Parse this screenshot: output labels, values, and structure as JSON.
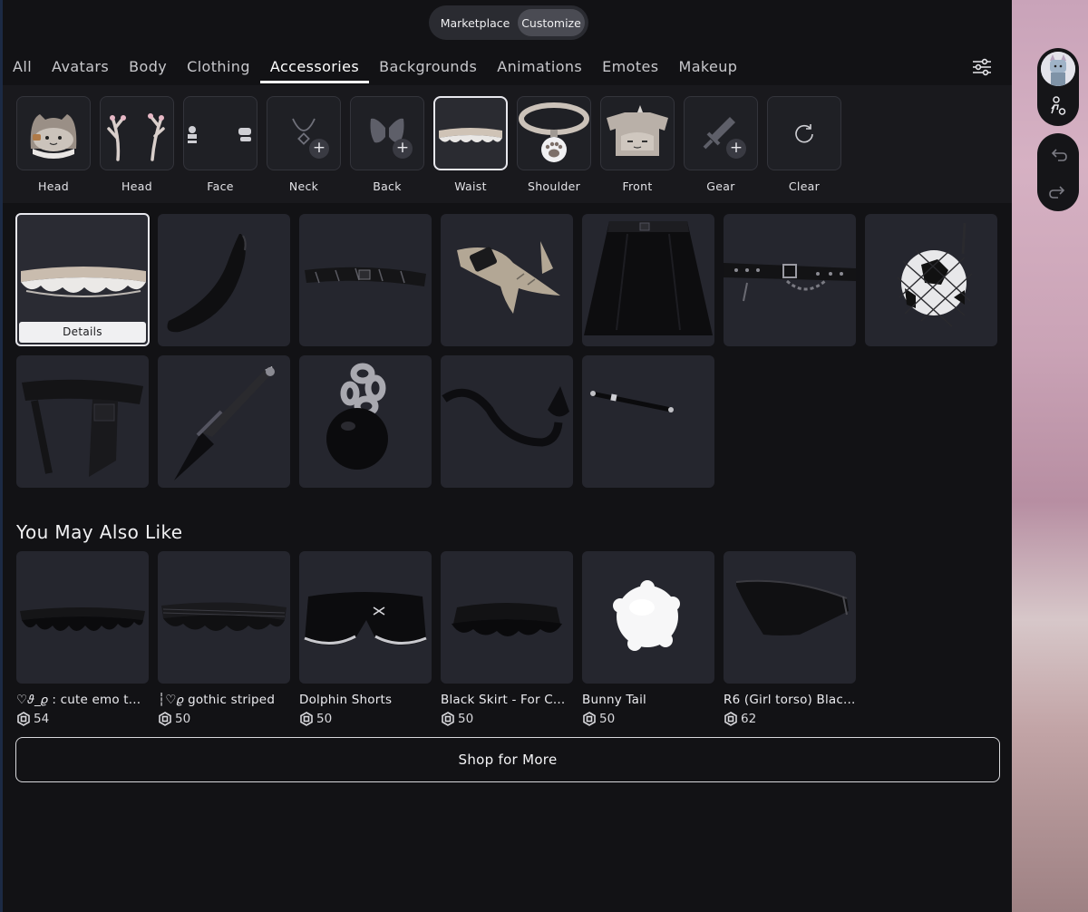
{
  "mode_toggle": {
    "marketplace": "Marketplace",
    "customize": "Customize"
  },
  "tabs": [
    "All",
    "Avatars",
    "Body",
    "Clothing",
    "Accessories",
    "Backgrounds",
    "Animations",
    "Emotes",
    "Makeup"
  ],
  "active_tab": "Accessories",
  "slots": [
    {
      "label": "Head",
      "icon": "cat-hat-icon"
    },
    {
      "label": "Head",
      "icon": "antlers-icon"
    },
    {
      "label": "Face",
      "icon": "face-accessory-icon"
    },
    {
      "label": "Neck",
      "icon": "necklace-icon"
    },
    {
      "label": "Back",
      "icon": "wings-icon"
    },
    {
      "label": "Waist",
      "icon": "ruffle-skirt-icon"
    },
    {
      "label": "Shoulder",
      "icon": "paw-collar-icon"
    },
    {
      "label": "Front",
      "icon": "cat-shirt-icon"
    },
    {
      "label": "Gear",
      "icon": "sword-icon"
    },
    {
      "label": "Clear",
      "icon": "reset-icon"
    }
  ],
  "active_slot": "Waist",
  "details_label": "Details",
  "section_title": "You May Also Like",
  "recommended": [
    {
      "name": "♡𝜗_𝜚 : cute emo t...",
      "price": "54"
    },
    {
      "name": "┆♡𝜚 gothic striped",
      "price": "50"
    },
    {
      "name": "Dolphin Shorts",
      "price": "50"
    },
    {
      "name": "Black Skirt - For C...",
      "price": "50"
    },
    {
      "name": "Bunny Tail",
      "price": "50"
    },
    {
      "name": "R6 (Girl torso) Blac...",
      "price": "62"
    }
  ],
  "shop_button": "Shop for More",
  "colors": {
    "background": "#121215",
    "card": "#25262e",
    "accent": "#ffffff"
  }
}
